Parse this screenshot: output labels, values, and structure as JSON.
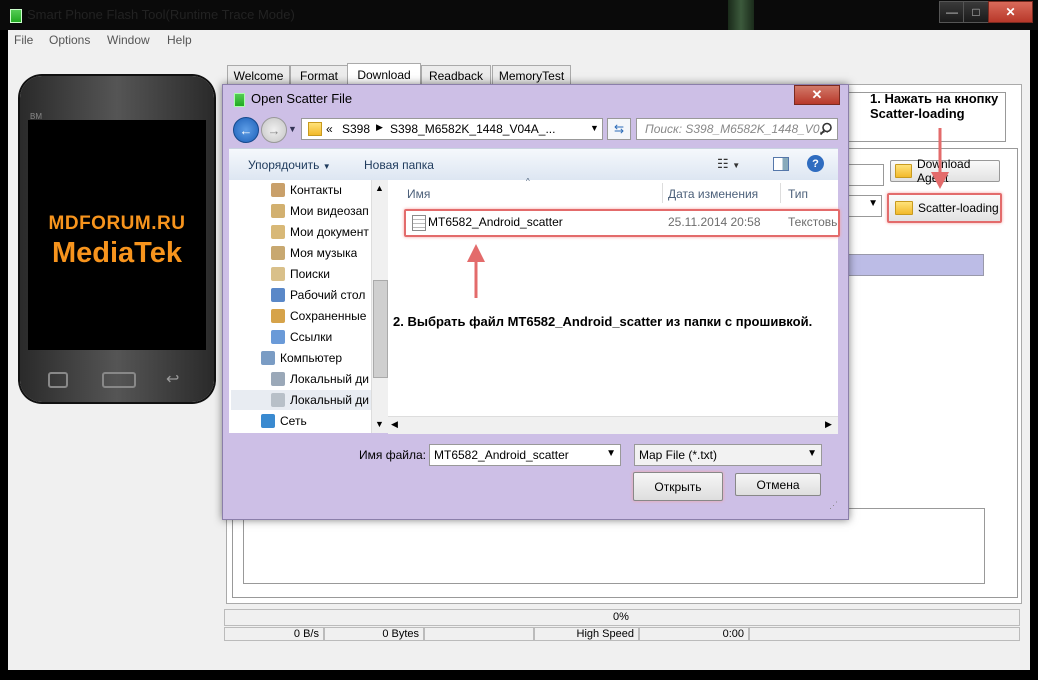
{
  "window": {
    "title": "Smart Phone Flash Tool(Runtime Trace Mode)",
    "controls": {
      "minimize": "—",
      "maximize": "□",
      "close": "✕"
    }
  },
  "menu": [
    "File",
    "Options",
    "Window",
    "Help"
  ],
  "phone": {
    "brand": "BM",
    "line1": "MDFORUM.RU",
    "line2": "MediaTek"
  },
  "tabs": [
    "Welcome",
    "Format",
    "Download",
    "Readback",
    "MemoryTest"
  ],
  "active_tab": "Download",
  "main": {
    "download_agent_label": "Download Agent",
    "scatter_loading_label": "Scatter-loading"
  },
  "annotations": {
    "step1_line1": "1. Нажать на кнопку",
    "step1_line2": "Scatter-loading",
    "step2": "2. Выбрать файл MT6582_Android_scatter из папки с прошивкой."
  },
  "status": {
    "progress_text": "0%",
    "progress_value": 0,
    "speed": "0 B/s",
    "bytes": "0 Bytes",
    "mode": "High Speed",
    "time": "0:00"
  },
  "dialog": {
    "title": "Open Scatter File",
    "close": "✕",
    "address": {
      "prefix": "«",
      "part1": "S398",
      "part2": "S398_M6582K_1448_V04A_..."
    },
    "search_placeholder": "Поиск: S398_M6582K_1448_V0...",
    "toolbar": {
      "organize": "Упорядочить",
      "new_folder": "Новая папка"
    },
    "nav_items": [
      {
        "label": "Контакты",
        "icon": "contacts-icon"
      },
      {
        "label": "Мои видеозап",
        "icon": "videos-icon"
      },
      {
        "label": "Мои документ",
        "icon": "documents-icon"
      },
      {
        "label": "Моя музыка",
        "icon": "music-icon"
      },
      {
        "label": "Поиски",
        "icon": "searches-icon"
      },
      {
        "label": "Рабочий стол",
        "icon": "desktop-icon"
      },
      {
        "label": "Сохраненные",
        "icon": "saved-games-icon"
      },
      {
        "label": "Ссылки",
        "icon": "links-icon"
      },
      {
        "label": "Компьютер",
        "icon": "computer-icon"
      },
      {
        "label": "Локальный ди",
        "icon": "drive-icon"
      },
      {
        "label": "Локальный ди",
        "icon": "drive-icon"
      },
      {
        "label": "Сеть",
        "icon": "network-icon"
      }
    ],
    "columns": {
      "name": "Имя",
      "date": "Дата изменения",
      "type": "Тип"
    },
    "files": [
      {
        "name": "MT6582_Android_scatter",
        "date": "25.11.2014 20:58",
        "type": "Текстовь"
      }
    ],
    "filename_label": "Имя файла:",
    "filename_value": "MT6582_Android_scatter",
    "filter_value": "Map File (*.txt)",
    "open_button": "Открыть",
    "cancel_button": "Отмена"
  },
  "colors": {
    "annotation_red": "#e36b6b",
    "brand_orange": "#f7941d",
    "dialog_frame": "#cdbfe6"
  }
}
